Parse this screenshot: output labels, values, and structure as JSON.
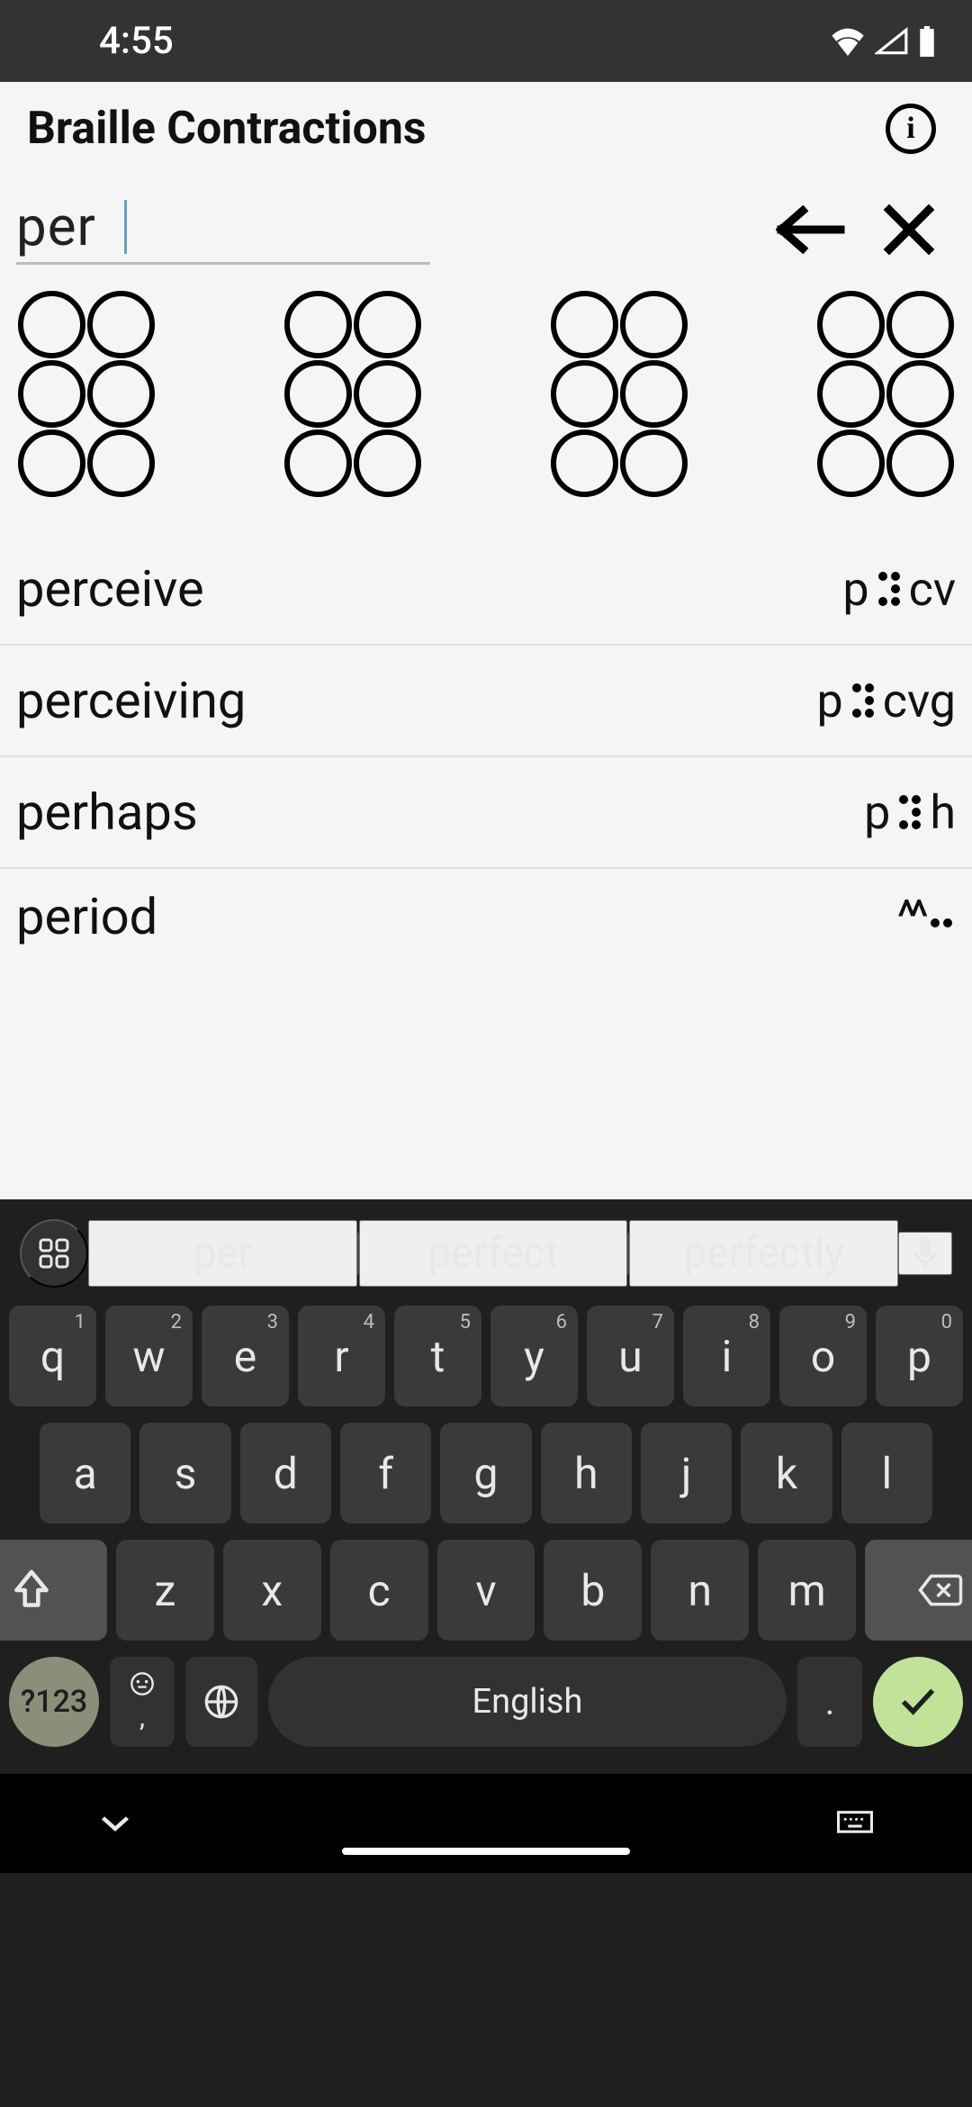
{
  "status": {
    "time": "4:55"
  },
  "header": {
    "title": "Braille Contractions"
  },
  "search": {
    "value": "per"
  },
  "results": [
    {
      "word": "perceive",
      "prefix": "p",
      "dots": [
        1,
        1,
        0,
        1,
        1,
        1
      ],
      "suffix": "cv"
    },
    {
      "word": "perceiving",
      "prefix": "p",
      "dots": [
        1,
        1,
        0,
        1,
        1,
        1
      ],
      "suffix": "cvg"
    },
    {
      "word": "perhaps",
      "prefix": "p",
      "dots": [
        1,
        1,
        0,
        1,
        1,
        1
      ],
      "suffix": "h"
    },
    {
      "word": "period",
      "prefix": "^^",
      "dots": [
        0,
        0,
        1,
        1,
        0,
        0
      ],
      "suffix": ""
    }
  ],
  "keyboard": {
    "suggestions": [
      "per",
      "perfect",
      "perfectly"
    ],
    "row1": [
      {
        "k": "q",
        "n": "1"
      },
      {
        "k": "w",
        "n": "2"
      },
      {
        "k": "e",
        "n": "3"
      },
      {
        "k": "r",
        "n": "4"
      },
      {
        "k": "t",
        "n": "5"
      },
      {
        "k": "y",
        "n": "6"
      },
      {
        "k": "u",
        "n": "7"
      },
      {
        "k": "i",
        "n": "8"
      },
      {
        "k": "o",
        "n": "9"
      },
      {
        "k": "p",
        "n": "0"
      }
    ],
    "row2": [
      "a",
      "s",
      "d",
      "f",
      "g",
      "h",
      "j",
      "k",
      "l"
    ],
    "row3": [
      "z",
      "x",
      "c",
      "v",
      "b",
      "n",
      "m"
    ],
    "numSym": "?123",
    "comma": ",",
    "space": "English",
    "period": "."
  }
}
